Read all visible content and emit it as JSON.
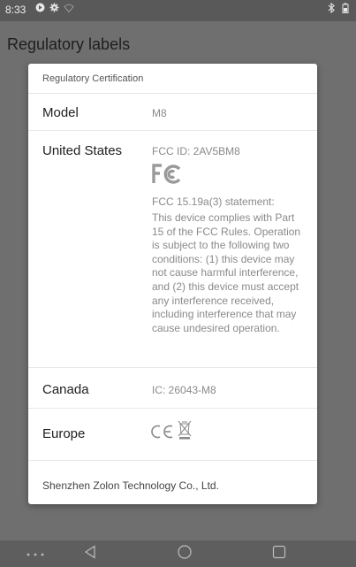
{
  "status_bar": {
    "time": "8:33",
    "left_icons": [
      "notification-badge-icon",
      "settings-gear-icon",
      "wifi-off-icon"
    ],
    "right_icons": [
      "bluetooth-icon",
      "battery-icon"
    ]
  },
  "app_bar": {
    "title": "Regulatory labels"
  },
  "dialog": {
    "header": "Regulatory Certification",
    "model": {
      "label": "Model",
      "value": "M8"
    },
    "united_states": {
      "label": "United States",
      "fcc_id": "FCC ID: 2AV5BM8",
      "statement_heading": "FCC 15.19a(3) statement:",
      "statement_body": "This device complies with Part 15 of the FCC Rules. Operation is subject to the following two conditions: (1) this device may not cause harmful interference, and (2) this device must accept any interference received, including interference that may cause undesired operation."
    },
    "canada": {
      "label": "Canada",
      "value": "IC: 26043-M8"
    },
    "europe": {
      "label": "Europe",
      "marks": [
        "ce-mark-icon",
        "weee-bin-icon"
      ]
    },
    "manufacturer": "Shenzhen Zolon Technology Co., Ltd."
  },
  "nav_bar": {
    "buttons": [
      "menu-dots",
      "back",
      "home",
      "recents"
    ]
  },
  "colors": {
    "scrim": "#6f6f6f",
    "dialog_bg": "#ffffff",
    "label_text": "#202020",
    "value_text": "#8a8a8a",
    "divider": "#e8e8e8"
  }
}
